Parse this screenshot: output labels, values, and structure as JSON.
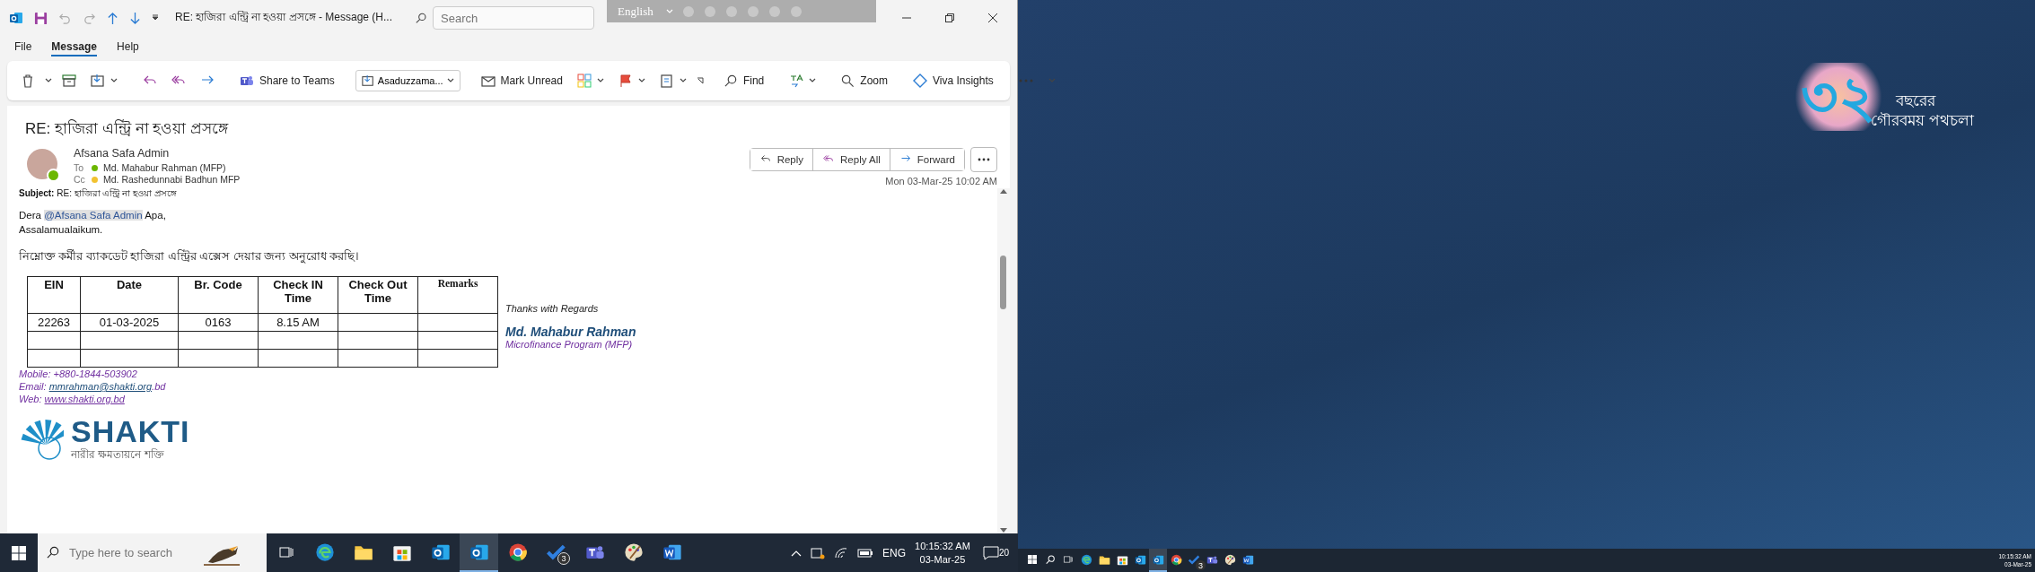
{
  "outlook": {
    "title_bar": {
      "title": "RE: হাজিরা এন্ট্রি না হওয়া প্রসঙ্গে  -  Message (H...",
      "search_placeholder": "Search"
    },
    "language_bar": {
      "language": "English"
    },
    "menu_tabs": [
      {
        "label": "File",
        "selected": false
      },
      {
        "label": "Message",
        "selected": true
      },
      {
        "label": "Help",
        "selected": false
      }
    ],
    "ribbon": {
      "share": "Share to Teams",
      "move_to": "Asaduzzama...",
      "mark_unread": "Mark Unread",
      "find": "Find",
      "zoom": "Zoom",
      "insights": "Viva Insights"
    },
    "message": {
      "subject": "RE: হাজিরা এন্ট্রি না হওয়া প্রসঙ্গে",
      "sender": "Afsana Safa Admin",
      "sender_online": true,
      "recipients": [
        {
          "label": "To",
          "name": "Md. Mahabur Rahman (MFP)",
          "color": "#6bb700"
        },
        {
          "label": "Cc",
          "name": "Md. Rashedunnabi Badhun MFP",
          "color": "#f2c230"
        }
      ],
      "actions": [
        {
          "kind": "reply",
          "label": "Reply"
        },
        {
          "kind": "reply_all",
          "label": "Reply All"
        },
        {
          "kind": "forward",
          "label": "Forward"
        }
      ],
      "date": "Mon 03-Mar-25 10:02 AM"
    },
    "body": {
      "subject_label": "Subject:",
      "subject_text": "RE: হাজিরা এন্ট্রি না হওয়া প্রসঙ্গে",
      "greeting_prefix": "Dera",
      "mention": "@Afsana Safa Admin",
      "greeting_suffix": "Apa,",
      "salutation": "Assalamualaikum.",
      "request": "নিম্নোক্ত কর্মীর ব্যাকডেট হাজিরা এন্ট্রির এক্সেস দেয়ার জন্য অনুরোধ করছি।",
      "table": {
        "columns": [
          "EIN",
          "Date",
          "Br. Code",
          "Check IN Time",
          "Check Out Time",
          "Remarks"
        ],
        "rows": [
          {
            "ein": "22263",
            "date": "01-03-2025",
            "br_code": "0163",
            "check_in": "8.15 AM"
          }
        ]
      },
      "signature": {
        "closing": "Thanks with Regards",
        "name": "Md. Mahabur Rahman",
        "department": "Microfinance Program (MFP)",
        "mobile": "Mobile: +880-1844-503902",
        "email_label": "Email:",
        "email": "mmrahman@shakti.org",
        "email_tail": ".bd",
        "web_label": "Web:",
        "web": "www.shakti.org.bd"
      },
      "logo": {
        "name": "SHAKTI",
        "tagline": "নারীর ক্ষমতায়নে শক্তি"
      }
    }
  },
  "taskbar": {
    "search_placeholder": "Type here to search",
    "apps": [
      {
        "kind": "edge",
        "selected": false
      },
      {
        "kind": "explorer",
        "selected": false
      },
      {
        "kind": "store",
        "selected": false
      },
      {
        "kind": "outlook_new",
        "selected": false
      },
      {
        "kind": "outlook",
        "selected": true
      },
      {
        "kind": "chrome",
        "selected": false
      },
      {
        "kind": "todo",
        "selected": false,
        "badge": "3"
      },
      {
        "kind": "teams",
        "selected": false
      },
      {
        "kind": "paint",
        "selected": false
      },
      {
        "kind": "word",
        "selected": false
      }
    ],
    "language": "ENG",
    "time": "10:15:32 AM",
    "date": "03-Mar-25",
    "notifications": "20"
  },
  "desktop": {
    "logo": {
      "number": "৩২",
      "line_1": "বছরের",
      "line_2": "গৌরবময় পথচলা"
    },
    "taskbar": {
      "apps": [
        {
          "kind": "edge",
          "selected": false
        },
        {
          "kind": "explorer",
          "selected": false
        },
        {
          "kind": "store",
          "selected": false
        },
        {
          "kind": "outlook_new",
          "selected": false
        },
        {
          "kind": "outlook",
          "selected": true
        },
        {
          "kind": "chrome",
          "selected": false
        },
        {
          "kind": "todo",
          "selected": false,
          "badge": "3"
        },
        {
          "kind": "teams",
          "selected": false
        },
        {
          "kind": "paint",
          "selected": false
        },
        {
          "kind": "word",
          "selected": false
        }
      ],
      "time": "10:15:32 AM",
      "date": "03-Mar-25"
    }
  }
}
